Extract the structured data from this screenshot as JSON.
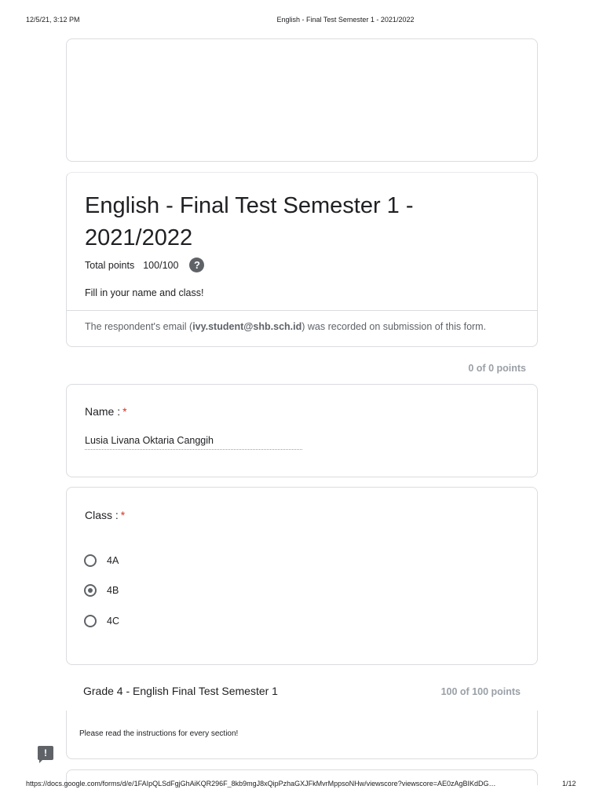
{
  "print_header": {
    "datetime": "12/5/21, 3:12 PM",
    "title": "English - Final Test Semester 1 - 2021/2022"
  },
  "form": {
    "title": "English - Final Test Semester 1 - 2021/2022",
    "total_points_label": "Total points",
    "total_points_value": "100/100",
    "help_icon": "help-circle-icon",
    "description": "Fill in your name and class!",
    "email_note_prefix": "The respondent's email (",
    "email": "ivy.student@shb.sch.id",
    "email_note_suffix": ") was recorded on submission of this form."
  },
  "section0": {
    "points": "0 of 0 points"
  },
  "questions": {
    "name": {
      "label": "Name :",
      "required_mark": "*",
      "answer": "Lusia Livana Oktaria Canggih"
    },
    "class": {
      "label": "Class :",
      "required_mark": "*",
      "options": [
        "4A",
        "4B",
        "4C"
      ],
      "selected": "4B"
    }
  },
  "section1": {
    "title": "Grade 4 - English Final Test Semester 1",
    "points": "100 of 100 points",
    "instructions": "Please read the instructions for every section!"
  },
  "feedback_icon": "feedback-icon",
  "print_footer": {
    "url": "https://docs.google.com/forms/d/e/1FAIpQLSdFgjGhAiKQR296F_8kb9mgJ8xQipPzhaGXJFkMvrMppsoNHw/viewscore?viewscore=AE0zAgBIKdDG…",
    "page": "1/12"
  },
  "colors": {
    "required": "#d93025",
    "muted": "#5f6368",
    "border": "#dadce0"
  }
}
